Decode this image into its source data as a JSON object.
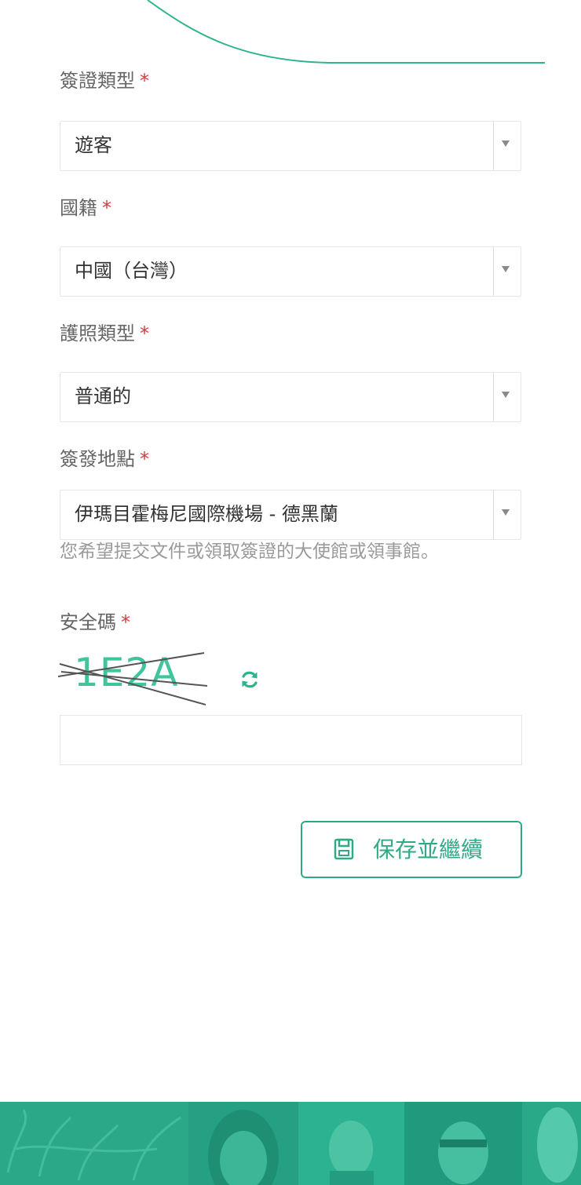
{
  "form": {
    "visa_type": {
      "label": "簽證類型",
      "required_mark": "*",
      "value": "遊客"
    },
    "nationality": {
      "label": "國籍",
      "required_mark": "*",
      "value": "中國（台灣）"
    },
    "passport_type": {
      "label": "護照類型",
      "required_mark": "*",
      "value": "普通的"
    },
    "issue_place": {
      "label": "簽發地點",
      "required_mark": "*",
      "value": "伊瑪目霍梅尼國際機場 - 德黑蘭",
      "help": "您希望提交文件或領取簽證的大使館或領事館。"
    },
    "security_code": {
      "label": "安全碼",
      "required_mark": "*",
      "captcha_text": "1E2A",
      "input_value": ""
    }
  },
  "actions": {
    "save_continue_label": "保存並繼續"
  },
  "colors": {
    "accent": "#30a987",
    "required": "#d93a3a",
    "footer": "#2bb28f"
  }
}
